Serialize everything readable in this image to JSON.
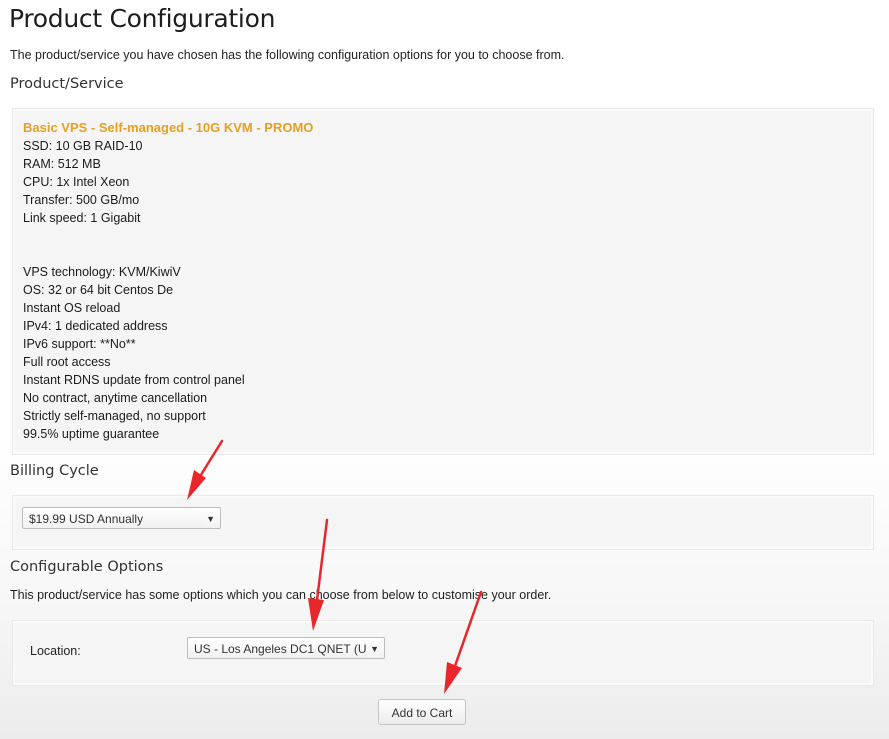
{
  "page": {
    "title": "Product Configuration",
    "intro": "The product/service you have chosen has the following configuration options for you to choose from."
  },
  "product_section": {
    "heading": "Product/Service",
    "product_name": "Basic VPS - Self-managed - 10G KVM - PROMO",
    "specs": [
      "SSD: 10 GB RAID-10",
      "RAM: 512 MB",
      "CPU: 1x Intel Xeon",
      "Transfer: 500 GB/mo",
      "Link speed: 1 Gigabit"
    ],
    "features": [
      "VPS technology: KVM/KiwiV",
      "OS: 32 or 64 bit Centos De",
      "Instant OS reload",
      "IPv4: 1 dedicated address",
      "IPv6 support: **No**",
      "Full root access",
      "Instant RDNS update from control panel",
      "No contract, anytime cancellation",
      "Strictly self-managed, no support",
      "99.5% uptime guarantee"
    ]
  },
  "billing": {
    "heading": "Billing Cycle",
    "selected": "$19.99 USD Annually"
  },
  "configurable_options": {
    "heading": "Configurable Options",
    "description": "This product/service has some options which you can choose from below to customise your order.",
    "location_label": "Location:",
    "location_selected": "US - Los Angeles DC1 QNET (U"
  },
  "actions": {
    "add_to_cart": "Add to Cart"
  },
  "annotation_color": "#e8262b",
  "icons": {
    "dropdown": "triangle-down-icon"
  },
  "dropdown_glyph": "▼"
}
